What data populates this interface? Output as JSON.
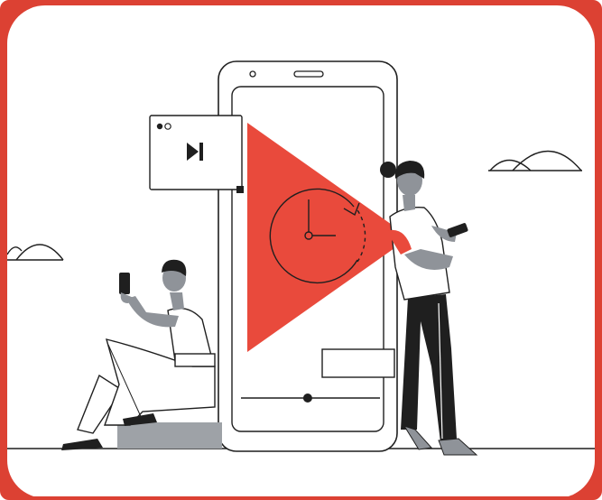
{
  "colors": {
    "accent_red": "#dc4133",
    "play_red": "#e94a3c",
    "ink": "#1f1f1f",
    "skin_gray": "#8f9399",
    "light_gray": "#c8cbcf",
    "block_gray": "#9ea2a7",
    "paper": "#ffffff"
  },
  "icons": [
    "play-triangle-icon",
    "clock-icon",
    "skip-next-icon",
    "camera-icon",
    "speaker-icon"
  ],
  "player": {
    "progress": 0.48
  }
}
